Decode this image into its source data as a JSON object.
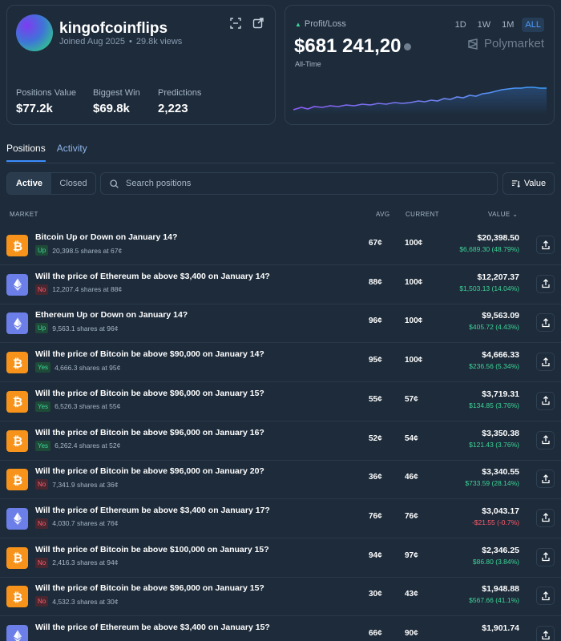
{
  "profile": {
    "username": "kingofcoinflips",
    "joined": "Joined Aug 2025",
    "views": "29.8k views",
    "stats": [
      {
        "label": "Positions Value",
        "value": "$77.2k"
      },
      {
        "label": "Biggest Win",
        "value": "$69.8k"
      },
      {
        "label": "Predictions",
        "value": "2,223"
      }
    ]
  },
  "pnl": {
    "label": "Profit/Loss",
    "value": "$681 241,20",
    "period_label": "All-Time",
    "ranges": [
      "1D",
      "1W",
      "1M",
      "ALL"
    ],
    "active_range": "ALL",
    "brand": "Polymarket"
  },
  "tabs": {
    "positions": "Positions",
    "activity": "Activity"
  },
  "filters": {
    "active": "Active",
    "closed": "Closed",
    "search_placeholder": "Search positions",
    "sort_label": "Value"
  },
  "table": {
    "headers": {
      "market": "MARKET",
      "avg": "AVG",
      "current": "CURRENT",
      "value": "VALUE"
    },
    "rows": [
      {
        "coin": "btc",
        "title": "Bitcoin Up or Down on January 14?",
        "outcome": "Up",
        "outcome_type": "yes",
        "shares": "20,398.5 shares at 67¢",
        "avg": "67¢",
        "current": "100¢",
        "value": "$20,398.50",
        "pnl": "$6,689.30 (48.79%)",
        "pnl_sign": "pos"
      },
      {
        "coin": "eth",
        "title": "Will the price of Ethereum be above $3,400 on January 14?",
        "outcome": "No",
        "outcome_type": "no",
        "shares": "12,207.4 shares at 88¢",
        "avg": "88¢",
        "current": "100¢",
        "value": "$12,207.37",
        "pnl": "$1,503.13 (14.04%)",
        "pnl_sign": "pos"
      },
      {
        "coin": "eth",
        "title": "Ethereum Up or Down on January 14?",
        "outcome": "Up",
        "outcome_type": "yes",
        "shares": "9,563.1 shares at 96¢",
        "avg": "96¢",
        "current": "100¢",
        "value": "$9,563.09",
        "pnl": "$405.72 (4.43%)",
        "pnl_sign": "pos"
      },
      {
        "coin": "btc",
        "title": "Will the price of Bitcoin be above $90,000 on January 14?",
        "outcome": "Yes",
        "outcome_type": "yes",
        "shares": "4,666.3 shares at 95¢",
        "avg": "95¢",
        "current": "100¢",
        "value": "$4,666.33",
        "pnl": "$236.56 (5.34%)",
        "pnl_sign": "pos"
      },
      {
        "coin": "btc",
        "title": "Will the price of Bitcoin be above $96,000 on January 15?",
        "outcome": "Yes",
        "outcome_type": "yes",
        "shares": "6,526.3 shares at 55¢",
        "avg": "55¢",
        "current": "57¢",
        "value": "$3,719.31",
        "pnl": "$134.85 (3.76%)",
        "pnl_sign": "pos"
      },
      {
        "coin": "btc",
        "title": "Will the price of Bitcoin be above $96,000 on January 16?",
        "outcome": "Yes",
        "outcome_type": "yes",
        "shares": "6,262.4 shares at 52¢",
        "avg": "52¢",
        "current": "54¢",
        "value": "$3,350.38",
        "pnl": "$121.43 (3.76%)",
        "pnl_sign": "pos"
      },
      {
        "coin": "btc",
        "title": "Will the price of Bitcoin be above $96,000 on January 20?",
        "outcome": "No",
        "outcome_type": "no",
        "shares": "7,341.9 shares at 36¢",
        "avg": "36¢",
        "current": "46¢",
        "value": "$3,340.55",
        "pnl": "$733.59 (28.14%)",
        "pnl_sign": "pos"
      },
      {
        "coin": "eth",
        "title": "Will the price of Ethereum be above $3,400 on January 17?",
        "outcome": "No",
        "outcome_type": "no",
        "shares": "4,030.7 shares at 76¢",
        "avg": "76¢",
        "current": "76¢",
        "value": "$3,043.17",
        "pnl": "-$21.55 (-0.7%)",
        "pnl_sign": "neg"
      },
      {
        "coin": "btc",
        "title": "Will the price of Bitcoin be above $100,000 on January 15?",
        "outcome": "No",
        "outcome_type": "no",
        "shares": "2,416.3 shares at 94¢",
        "avg": "94¢",
        "current": "97¢",
        "value": "$2,346.25",
        "pnl": "$86.80 (3.84%)",
        "pnl_sign": "pos"
      },
      {
        "coin": "btc",
        "title": "Will the price of Bitcoin be above $96,000 on January 15?",
        "outcome": "No",
        "outcome_type": "no",
        "shares": "4,532.3 shares at 30¢",
        "avg": "30¢",
        "current": "43¢",
        "value": "$1,948.88",
        "pnl": "$567.66 (41.1%)",
        "pnl_sign": "pos"
      },
      {
        "coin": "eth",
        "title": "Will the price of Ethereum be above $3,400 on January 15?",
        "outcome": "",
        "outcome_type": "no",
        "shares": "",
        "avg": "66¢",
        "current": "90¢",
        "value": "$1,901.74",
        "pnl": "",
        "pnl_sign": "pos"
      }
    ]
  },
  "colors": {
    "positive": "#3ed598",
    "negative": "#ff5c6c",
    "accent": "#3a8dff",
    "btc": "#f7931a",
    "eth": "#6c7fe8"
  }
}
